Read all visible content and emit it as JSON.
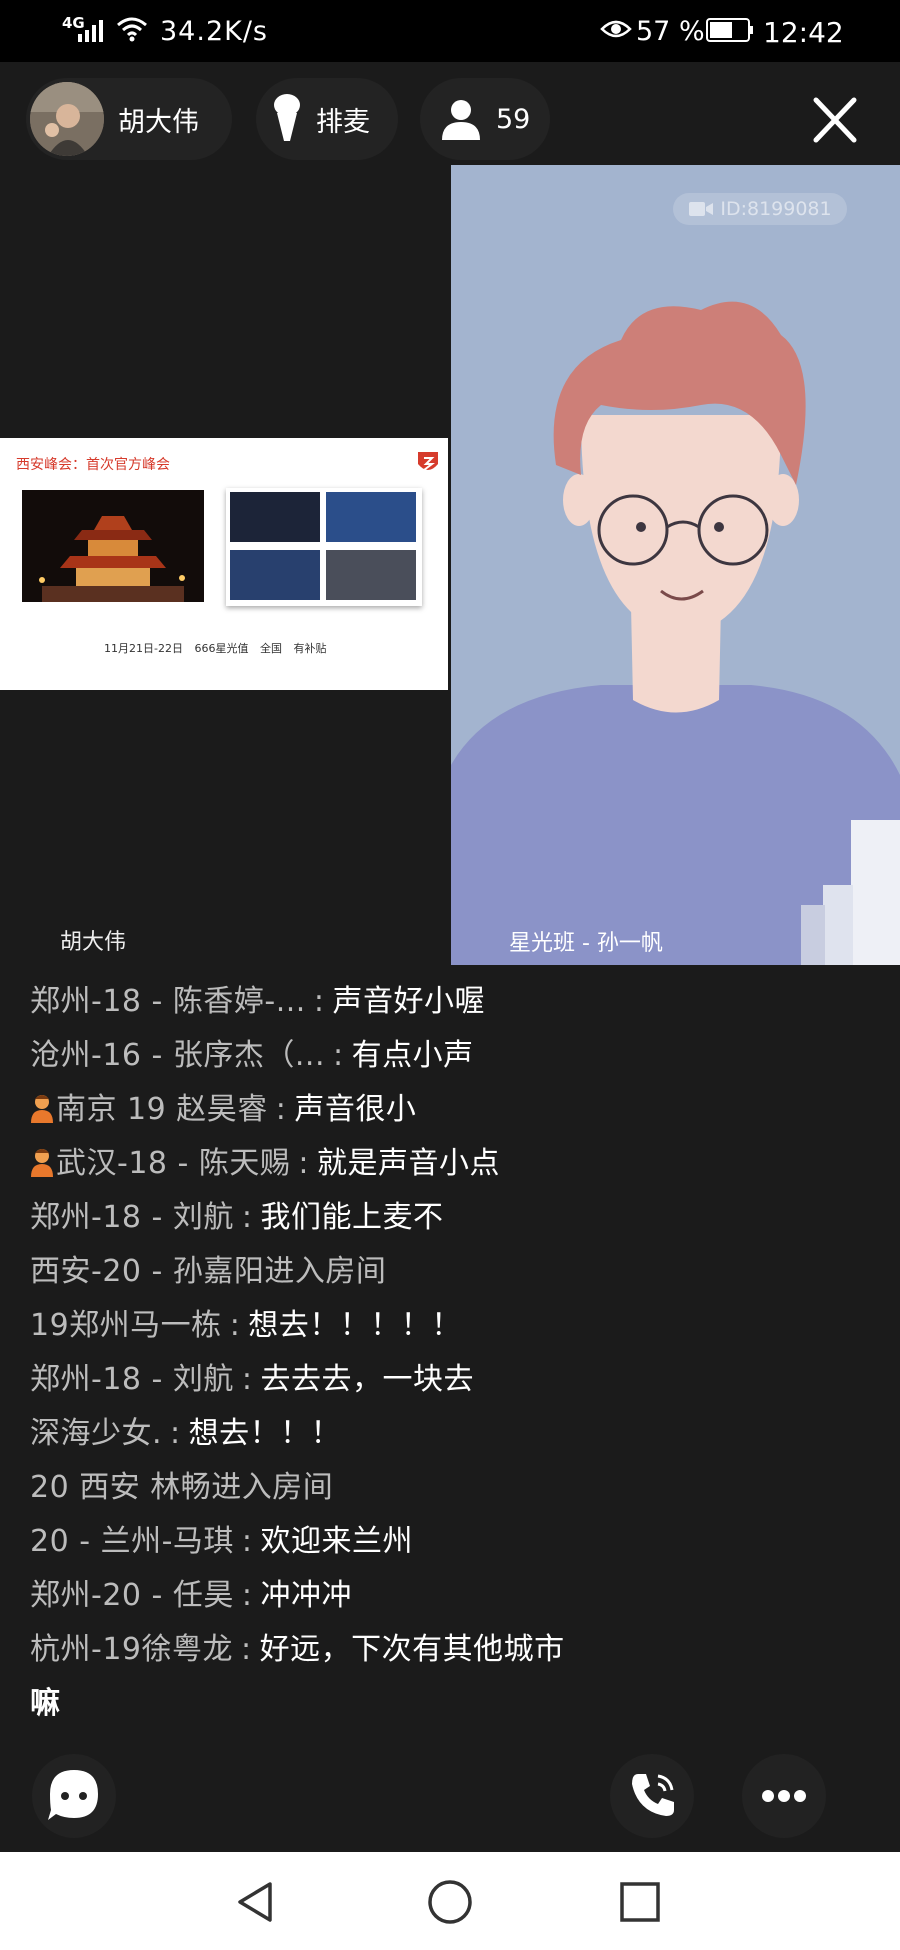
{
  "status_bar": {
    "network": "4G",
    "speed": "34.2K/s",
    "battery": "57 %",
    "time": "12:42"
  },
  "room_bar": {
    "host_name": "胡大伟",
    "queue_label": "排麦",
    "viewer_count": "59"
  },
  "presenter": {
    "host_label": "胡大伟",
    "slide": {
      "title": "西安峰会：首次官方峰会",
      "footer": "11月21日-22日 666星光值 全国 有补贴"
    }
  },
  "guest": {
    "id_badge": "ID:8199081",
    "label": "星光班 - 孙一帆"
  },
  "chat": [
    {
      "name": "郑州-18 - 陈香婷-...",
      "text": "声音好小喔",
      "badge": false,
      "type": "msg"
    },
    {
      "name": "沧州-16 - 张序杰（...",
      "text": "有点小声",
      "badge": false,
      "type": "msg"
    },
    {
      "name": "南京 19 赵昊睿",
      "text": "声音很小",
      "badge": true,
      "type": "msg"
    },
    {
      "name": "武汉-18 - 陈天赐",
      "text": "就是声音小点",
      "badge": true,
      "type": "msg"
    },
    {
      "name": "郑州-18 - 刘航",
      "text": "我们能上麦不",
      "badge": false,
      "type": "msg"
    },
    {
      "name": "西安-20 - 孙嘉阳进入房间",
      "text": "",
      "badge": false,
      "type": "sys"
    },
    {
      "name": "19郑州马一栋",
      "text": "想去！！！！！",
      "badge": false,
      "type": "msg"
    },
    {
      "name": "郑州-18 - 刘航",
      "text": "去去去，一块去",
      "badge": false,
      "type": "msg"
    },
    {
      "name": "深海少女.",
      "text": "想去！！！",
      "badge": false,
      "type": "msg"
    },
    {
      "name": "20 西安 林畅进入房间",
      "text": "",
      "badge": false,
      "type": "sys"
    },
    {
      "name": "20 - 兰州-马琪",
      "text": "欢迎来兰州",
      "badge": false,
      "type": "msg"
    },
    {
      "name": "郑州-20 - 任昊",
      "text": "冲冲冲",
      "badge": false,
      "type": "msg"
    },
    {
      "name": "杭州-19徐粤龙",
      "text": "好远，下次有其他城市",
      "badge": false,
      "type": "msg"
    }
  ],
  "chat_wrap": "嘛",
  "colors": {
    "background": "#1b1b1b",
    "guest_bg": "#a3b4cf",
    "accent_red": "#d63b2c"
  },
  "icons": [
    "signal-icon",
    "wifi-icon",
    "eye-icon",
    "battery-icon",
    "mic-icon",
    "person-icon",
    "close-icon",
    "camera-icon",
    "chat-icon",
    "phone-icon",
    "more-icon",
    "back-icon",
    "home-icon",
    "recents-icon"
  ]
}
